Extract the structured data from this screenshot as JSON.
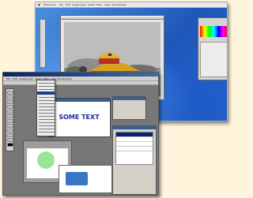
{
  "mac_menubar": {
    "items": [
      "Photoshop",
      "File",
      "Edit",
      "Image",
      "Layer",
      "Select",
      "Filter",
      "View",
      "Window",
      "Help"
    ]
  },
  "windows_menubar": {
    "items": [
      "File",
      "Edit",
      "Image",
      "Layer",
      "Select",
      "Filter",
      "View",
      "Window",
      "Help"
    ]
  },
  "canvas": {
    "text": "SOME TEXT"
  },
  "colors": {
    "background": "#fff5dc",
    "mac_desktop": "#2f6cc9",
    "workspace": "#777777",
    "canvas_text": "#1c2a9e",
    "green_circle": "#98e59a",
    "blue_rectangle": "#3a76c8"
  }
}
